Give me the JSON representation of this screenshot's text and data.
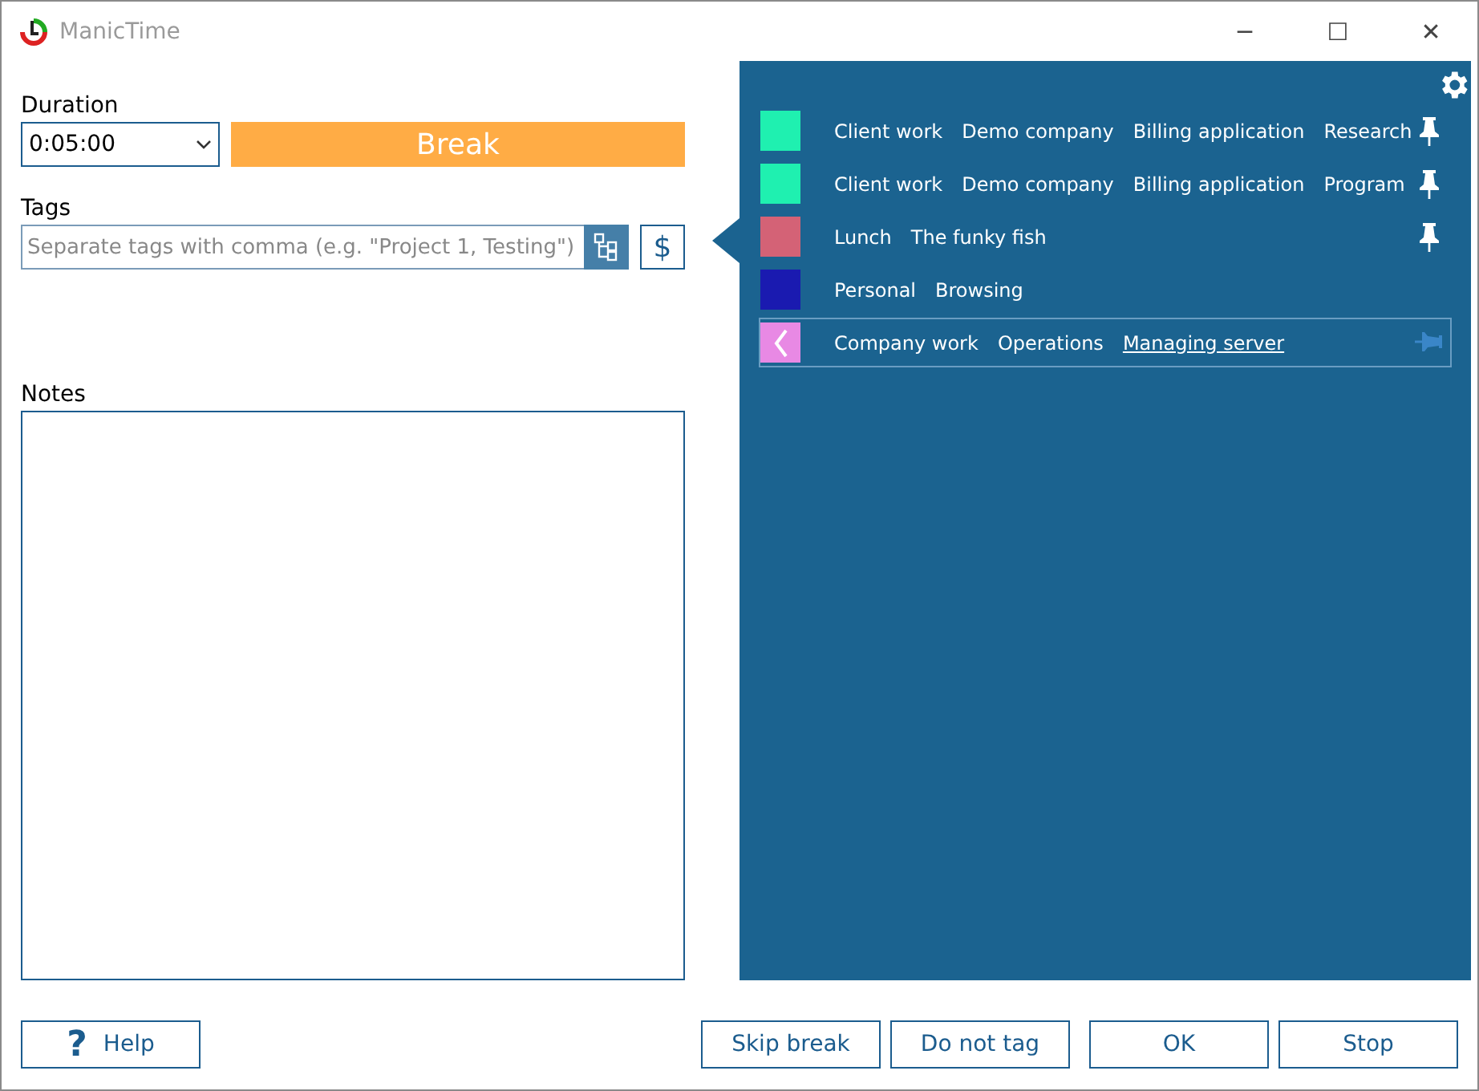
{
  "window": {
    "title": "ManicTime",
    "controls": [
      "─",
      "☐",
      "✕"
    ]
  },
  "duration": {
    "label": "Duration",
    "value": "0:05:00",
    "activity": "Break"
  },
  "tags": {
    "label": "Tags",
    "placeholder": "Separate tags with comma (e.g. \"Project 1, Testing\")",
    "currency_symbol": "$"
  },
  "notes": {
    "label": "Notes"
  },
  "recent_tags": [
    {
      "color": "#1ff0b0",
      "selected": false,
      "pinned": true,
      "tags": [
        {
          "text": "Client work",
          "link": false
        },
        {
          "text": "Demo company",
          "link": false
        },
        {
          "text": "Billing application",
          "link": false
        },
        {
          "text": "Research",
          "link": false
        }
      ]
    },
    {
      "color": "#1ff0b0",
      "selected": false,
      "pinned": true,
      "tags": [
        {
          "text": "Client work",
          "link": false
        },
        {
          "text": "Demo company",
          "link": false
        },
        {
          "text": "Billing application",
          "link": false
        },
        {
          "text": "Program",
          "link": false
        }
      ]
    },
    {
      "color": "#d46276",
      "selected": false,
      "pinned": true,
      "tags": [
        {
          "text": "Lunch",
          "link": false
        },
        {
          "text": "The funky fish",
          "link": false
        }
      ]
    },
    {
      "color": "#1a1ab0",
      "selected": false,
      "pinned": false,
      "tags": [
        {
          "text": "Personal",
          "link": false
        },
        {
          "text": "Browsing",
          "link": false
        }
      ]
    },
    {
      "color": "#e889e4",
      "selected": true,
      "pinned": false,
      "tags": [
        {
          "text": "Company work",
          "link": false
        },
        {
          "text": "Operations",
          "link": false
        },
        {
          "text": "Managing server",
          "link": true
        }
      ]
    }
  ],
  "buttons": {
    "help": "Help",
    "help_icon": "?",
    "actions": [
      "Skip break",
      "Do not tag",
      "OK",
      "Stop"
    ]
  }
}
